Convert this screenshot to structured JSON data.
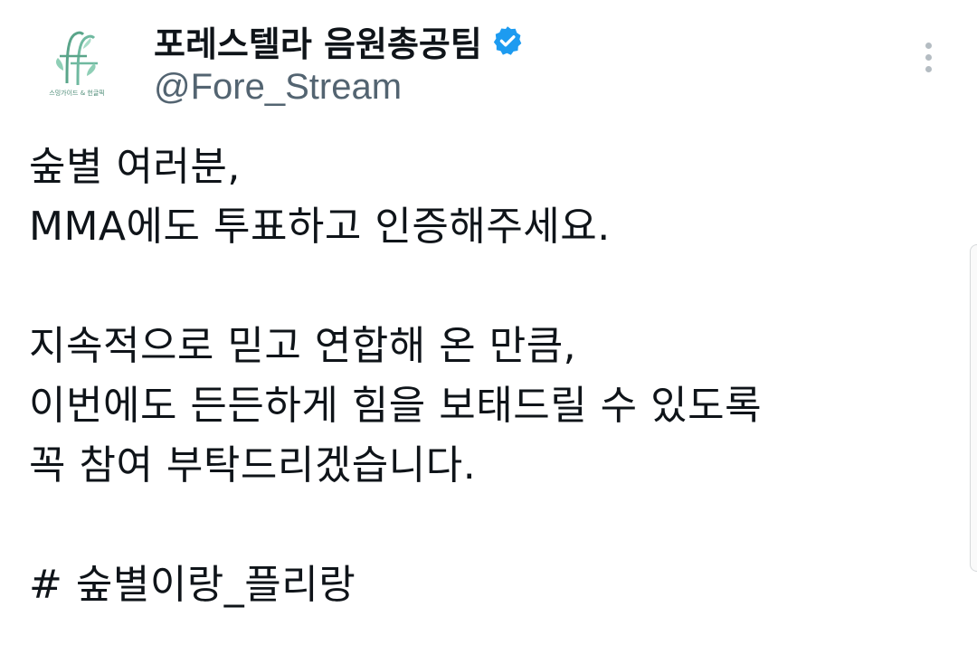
{
  "profile": {
    "display_name": "포레스텔라 음원총공팀",
    "handle": "@Fore_Stream",
    "verified": true,
    "avatar_caption": "스밍가이드 & 헌글픽",
    "avatar_icon": "leaf-ff-logo-icon"
  },
  "tweet": {
    "lines": [
      "숲별 여러분,",
      "MMA에도 투표하고 인증해주세요.",
      "",
      "지속적으로 믿고 연합해 온 만큼,",
      "이번에도 든든하게 힘을 보태드릴 수 있도록",
      "꼭 참여 부탁드리겠습니다.",
      "",
      "# 숲별이랑_플리랑"
    ]
  },
  "icons": {
    "verified": "verified-badge-icon",
    "more": "more-vertical-icon"
  },
  "colors": {
    "verified_badge": "#1d9bf0",
    "handle_text": "#536471",
    "body_text": "#0f1419",
    "logo_green": "#5aa58a"
  }
}
